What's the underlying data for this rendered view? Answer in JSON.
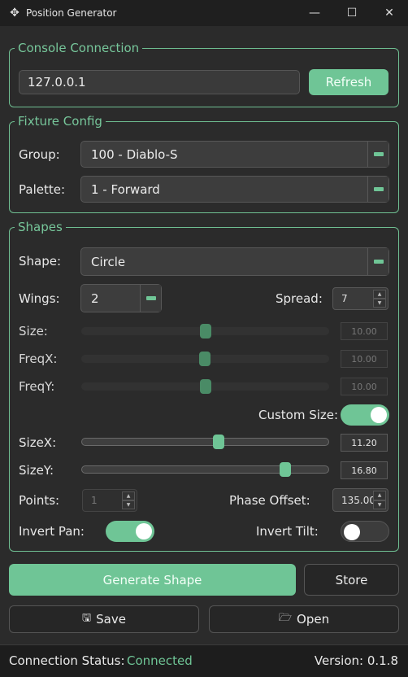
{
  "window": {
    "title": "Position Generator",
    "icon": "move-icon",
    "controls": [
      "minimize-icon",
      "maximize-icon",
      "close-icon"
    ]
  },
  "console_connection": {
    "legend": "Console Connection",
    "ip_value": "127.0.0.1",
    "refresh_label": "Refresh"
  },
  "fixture_config": {
    "legend": "Fixture Config",
    "group_label": "Group:",
    "group_value": "100 - Diablo-S",
    "palette_label": "Palette:",
    "palette_value": "1 - Forward"
  },
  "shapes": {
    "legend": "Shapes",
    "shape_label": "Shape:",
    "shape_value": "Circle",
    "wings_label": "Wings:",
    "wings_value": "2",
    "spread_label": "Spread:",
    "spread_value": "7",
    "size_label": "Size:",
    "size_value": "10.00",
    "freqx_label": "FreqX:",
    "freqx_value": "10.00",
    "freqy_label": "FreqY:",
    "freqy_value": "10.00",
    "custom_size_label": "Custom Size:",
    "custom_size_on": true,
    "sizex_label": "SizeX:",
    "sizex_value": "11.20",
    "sizey_label": "SizeY:",
    "sizey_value": "16.80",
    "points_label": "Points:",
    "points_value": "1",
    "phase_label": "Phase Offset:",
    "phase_value": "135.00",
    "invert_pan_label": "Invert Pan:",
    "invert_pan_on": true,
    "invert_tilt_label": "Invert Tilt:",
    "invert_tilt_on": false
  },
  "actions": {
    "generate_label": "Generate Shape",
    "store_label": "Store",
    "save_label": "Save",
    "open_label": "Open"
  },
  "status": {
    "connection_label": "Connection Status:",
    "connection_value": "Connected",
    "version_text": "Version: 0.1.8"
  },
  "colors": {
    "accent": "#6fc596",
    "background": "#2b2b2b"
  }
}
